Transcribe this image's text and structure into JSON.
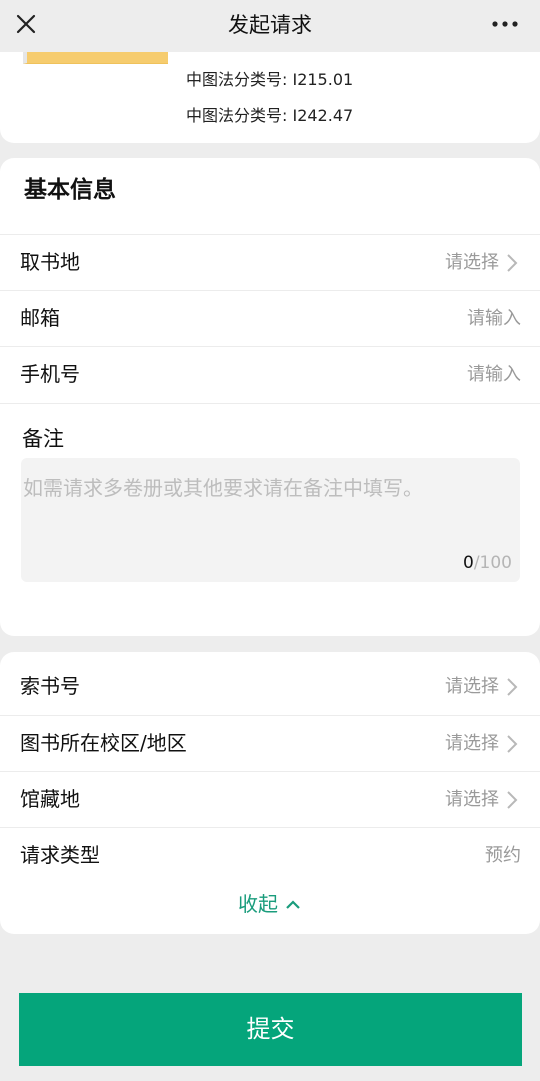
{
  "nav": {
    "title": "发起请求",
    "close_icon": "close-icon",
    "more_icon": "more-icon"
  },
  "book": {
    "clc_1": "中图法分类号: I215.01",
    "clc_2": "中图法分类号: I242.47",
    "cover_color": "#f6cc6e"
  },
  "basic_info": {
    "title": "基本信息",
    "pickup": {
      "label": "取书地",
      "value": "请选择"
    },
    "email": {
      "label": "邮箱",
      "placeholder": "请输入"
    },
    "phone": {
      "label": "手机号",
      "placeholder": "请输入"
    },
    "notes": {
      "label": "备注",
      "placeholder": "如需请求多卷册或其他要求请在备注中填写。",
      "count": "0",
      "max": "/100"
    }
  },
  "details": {
    "call_number": {
      "label": "索书号",
      "value": "请选择"
    },
    "campus": {
      "label": "图书所在校区/地区",
      "value": "请选择"
    },
    "location": {
      "label": "馆藏地",
      "value": "请选择"
    },
    "request_type": {
      "label": "请求类型",
      "value": "预约"
    },
    "collapse_label": "收起"
  },
  "footer": {
    "submit_label": "提交"
  },
  "colors": {
    "accent": "#05a57b",
    "link": "#1a9c7c",
    "background": "#ededed"
  }
}
